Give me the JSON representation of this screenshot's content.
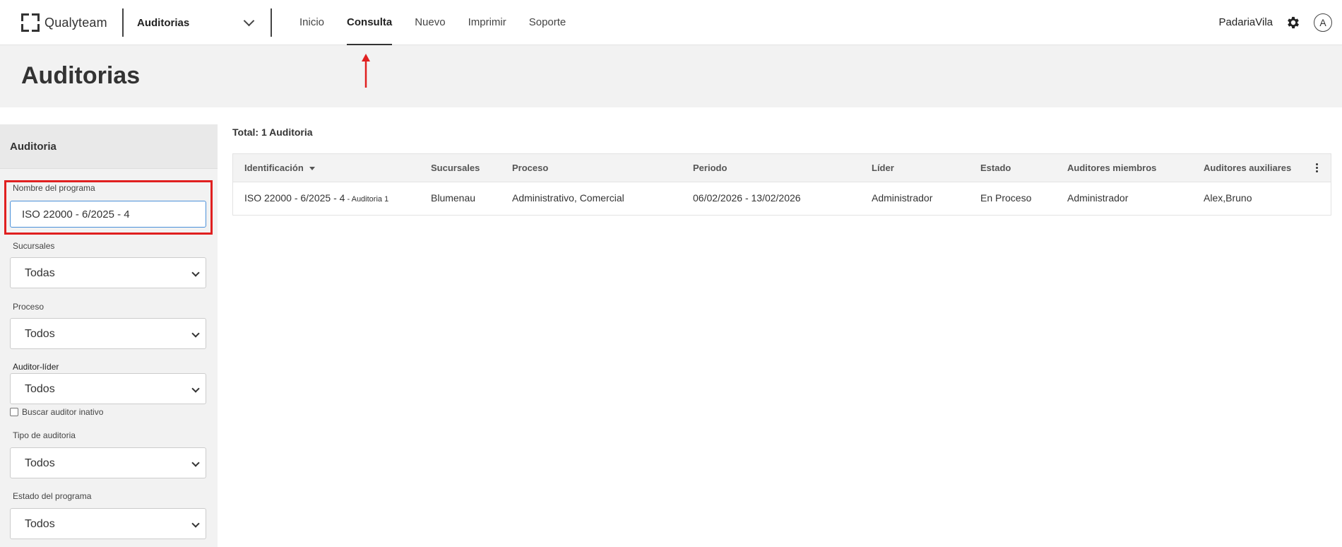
{
  "brand": {
    "name": "Qualyteam"
  },
  "header": {
    "module": "Auditorias",
    "nav": [
      {
        "label": "Inicio",
        "active": false
      },
      {
        "label": "Consulta",
        "active": true
      },
      {
        "label": "Nuevo",
        "active": false
      },
      {
        "label": "Imprimir",
        "active": false
      },
      {
        "label": "Soporte",
        "active": false
      }
    ],
    "user": "PadariaVila",
    "avatar_initial": "A",
    "icons": {
      "settings": "gear-icon",
      "module_dropdown": "chevron-down-icon"
    }
  },
  "page": {
    "title": "Auditorias"
  },
  "filters": {
    "title": "Auditoria",
    "program_name": {
      "label": "Nombre del programa",
      "value": "ISO 22000 - 6/2025 - 4"
    },
    "branches": {
      "label": "Sucursales",
      "value": "Todas"
    },
    "process": {
      "label": "Proceso",
      "value": "Todos"
    },
    "lead_auditor": {
      "label": "Auditor-líder",
      "value": "Todos"
    },
    "inactive_auditor": {
      "label": "Buscar auditor inativo",
      "checked": false
    },
    "audit_type": {
      "label": "Tipo de auditoria",
      "value": "Todos"
    },
    "program_status": {
      "label": "Estado del programa",
      "value": "Todos"
    }
  },
  "results": {
    "total": "Total: 1 Auditoria",
    "columns": [
      "Identificación",
      "Sucursales",
      "Proceso",
      "Periodo",
      "Líder",
      "Estado",
      "Auditores miembros",
      "Auditores auxiliares"
    ],
    "rows": [
      {
        "id_main": "ISO 22000 - 6/2025 - 4",
        "id_sub": " - Auditoria 1",
        "branch": "Blumenau",
        "process": "Administrativo, Comercial",
        "period": "06/02/2026 - 13/02/2026",
        "leader": "Administrador",
        "status": "En Proceso",
        "members": "Administrador",
        "auxiliaries": "Alex,Bruno"
      }
    ]
  },
  "colors": {
    "highlight": "#e02020",
    "input_focus": "#4a90d9",
    "header_bg": "#f2f2f2"
  }
}
